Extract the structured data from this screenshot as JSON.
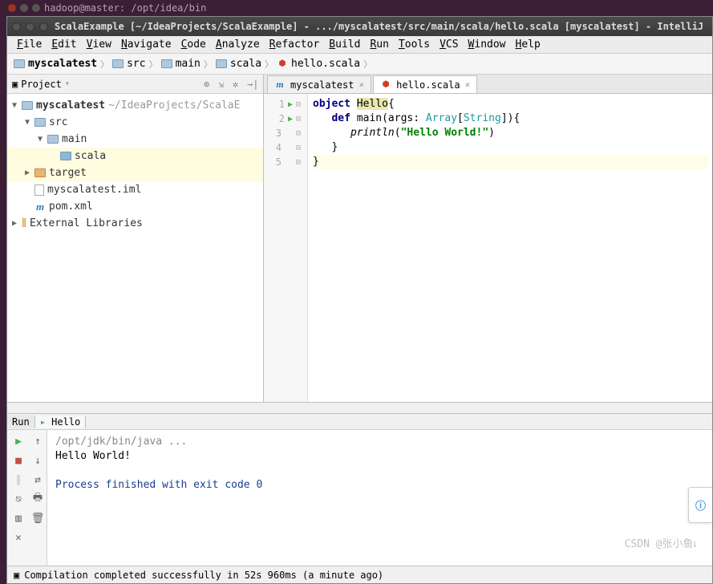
{
  "os_top": "hadoop@master: /opt/idea/bin",
  "title": "ScalaExample [~/IdeaProjects/ScalaExample] - .../myscalatest/src/main/scala/hello.scala [myscalatest] - IntelliJ",
  "menu": [
    "File",
    "Edit",
    "View",
    "Navigate",
    "Code",
    "Analyze",
    "Refactor",
    "Build",
    "Run",
    "Tools",
    "VCS",
    "Window",
    "Help"
  ],
  "breadcrumb": [
    "myscalatest",
    "src",
    "main",
    "scala",
    "hello.scala"
  ],
  "project": {
    "title": "Project",
    "root": {
      "label": "myscalatest",
      "path": "~/IdeaProjects/ScalaE"
    },
    "tree": [
      {
        "indent": 1,
        "arrow": "▼",
        "icon": "folder",
        "label": "src"
      },
      {
        "indent": 2,
        "arrow": "▼",
        "icon": "folder",
        "label": "main"
      },
      {
        "indent": 3,
        "arrow": "",
        "icon": "folder-blue",
        "label": "scala",
        "sel": true
      },
      {
        "indent": 1,
        "arrow": "▶",
        "icon": "folder-orange",
        "label": "target",
        "sel": true
      },
      {
        "indent": 1,
        "arrow": "",
        "icon": "file",
        "label": "myscalatest.iml"
      },
      {
        "indent": 1,
        "arrow": "",
        "icon": "m",
        "label": "pom.xml"
      }
    ],
    "external": "External Libraries"
  },
  "tabs": [
    {
      "icon": "m",
      "label": "myscalatest"
    },
    {
      "icon": "scala",
      "label": "hello.scala",
      "active": true
    }
  ],
  "code": {
    "lines": [
      {
        "n": 1,
        "run": true,
        "html": "<span class='kw'>object</span> <span class='hl'>Hello</span>{"
      },
      {
        "n": 2,
        "run": true,
        "html": "   <span class='kw'>def</span> main(args: <span class='cls'>Array</span>[<span class='cls'>String</span>]){"
      },
      {
        "n": 3,
        "html": "      <span class='fn'>println</span>(<span class='str'>\"Hello World!\"</span>)"
      },
      {
        "n": 4,
        "html": "   }"
      },
      {
        "n": 5,
        "caret": true,
        "html": "}"
      }
    ]
  },
  "run": {
    "tab_run": "Run",
    "tab_hello": "Hello",
    "output": [
      {
        "cls": "console-gray",
        "text": "/opt/jdk/bin/java ..."
      },
      {
        "cls": "",
        "text": "Hello World!"
      },
      {
        "cls": "",
        "text": ""
      },
      {
        "cls": "console-blue",
        "text": "Process finished with exit code 0"
      }
    ]
  },
  "status": "Compilation completed successfully in 52s 960ms (a minute ago)",
  "watermark": "CSDN @张小鱼เ"
}
